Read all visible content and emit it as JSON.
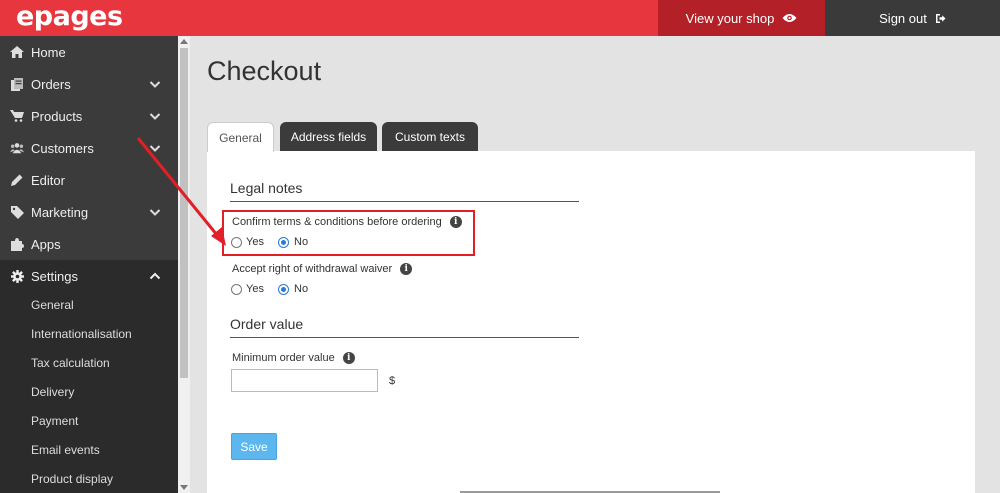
{
  "header": {
    "logo": "epages",
    "view_shop_label": "View your shop",
    "signout_label": "Sign out"
  },
  "sidebar": {
    "items": [
      {
        "label": "Home",
        "icon": "home-icon"
      },
      {
        "label": "Orders",
        "icon": "orders-icon",
        "has_chevron": true
      },
      {
        "label": "Products",
        "icon": "cart-icon",
        "has_chevron": true
      },
      {
        "label": "Customers",
        "icon": "users-icon",
        "has_chevron": true
      },
      {
        "label": "Editor",
        "icon": "pencil-icon"
      },
      {
        "label": "Marketing",
        "icon": "tag-icon",
        "has_chevron": true
      },
      {
        "label": "Apps",
        "icon": "puzzle-icon"
      },
      {
        "label": "Settings",
        "icon": "gear-icon",
        "expanded": true
      }
    ],
    "settings_subitems": [
      "General",
      "Internationalisation",
      "Tax calculation",
      "Delivery",
      "Payment",
      "Email events",
      "Product display"
    ]
  },
  "main": {
    "title": "Checkout",
    "tabs": [
      {
        "label": "General",
        "active": true
      },
      {
        "label": "Address fields",
        "active": false
      },
      {
        "label": "Custom texts",
        "active": false
      }
    ],
    "legal_notes": {
      "title": "Legal notes",
      "confirm_terms": {
        "label": "Confirm terms & conditions before ordering",
        "yes": "Yes",
        "no": "No",
        "selected": "No"
      },
      "withdrawal_waiver": {
        "label": "Accept right of withdrawal waiver",
        "yes": "Yes",
        "no": "No",
        "selected": "No"
      }
    },
    "order_value": {
      "title": "Order value",
      "min_label": "Minimum order value",
      "min_value": "",
      "currency": "$"
    },
    "save_label": "Save",
    "info_glyph": "i"
  },
  "colors": {
    "brand_red": "#e8363e",
    "view_shop_bg": "#b32027",
    "sidebar_bg": "#3b3b3b",
    "save_blue": "#5bb7ee",
    "highlight_red": "#e21e26"
  }
}
